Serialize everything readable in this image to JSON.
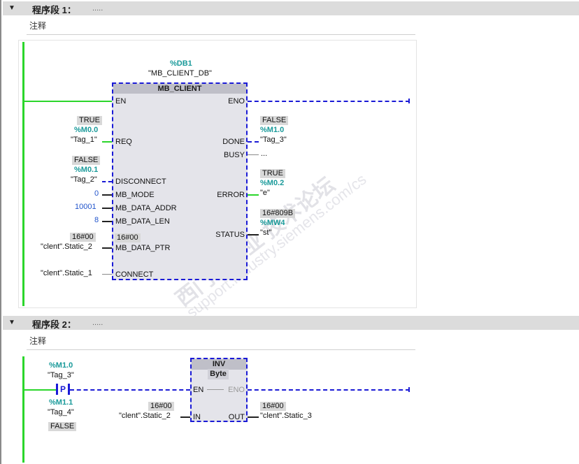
{
  "networks": [
    {
      "title": "程序段 1：",
      "dots": ".....",
      "comment": "注释",
      "block": {
        "db_address": "%DB1",
        "db_name": "\"MB_CLIENT_DB\"",
        "name": "MB_CLIENT",
        "inputs": [
          "EN",
          "REQ",
          "DISCONNECT",
          "MB_MODE",
          "MB_DATA_ADDR",
          "MB_DATA_LEN",
          "MB_DATA_PTR",
          "CONNECT"
        ],
        "outputs": [
          "ENO",
          "DONE",
          "BUSY",
          "ERROR",
          "STATUS"
        ],
        "ptr_value": "16#00"
      },
      "left_params": {
        "req": {
          "value": "TRUE",
          "address": "%M0.0",
          "tag": "\"Tag_1\""
        },
        "disconnect": {
          "value": "FALSE",
          "address": "%M0.1",
          "tag": "\"Tag_2\""
        },
        "mb_mode": "0",
        "mb_data_addr": "10001",
        "mb_data_len": "8",
        "mb_data_ptr": {
          "value": "16#00",
          "tag": "\"clent\".Static_2"
        },
        "connect": "\"clent\".Static_1"
      },
      "right_params": {
        "done": {
          "value": "FALSE",
          "address": "%M1.0",
          "tag": "\"Tag_3\""
        },
        "busy": "...",
        "error": {
          "value": "TRUE",
          "address": "%M0.2",
          "tag": "\"e\""
        },
        "status": {
          "value": "16#809B",
          "address": "%MW4",
          "tag": "\"st\""
        }
      }
    },
    {
      "title": "程序段 2：",
      "dots": ".....",
      "comment": "注释",
      "contact": {
        "address": "%M1.0",
        "tag": "\"Tag_3\"",
        "symbol": "P",
        "edge_address": "%M1.1",
        "edge_tag": "\"Tag_4\"",
        "edge_value": "FALSE"
      },
      "block": {
        "name": "INV",
        "type": "Byte",
        "inputs": [
          "EN",
          "IN"
        ],
        "outputs": [
          "ENO",
          "OUT"
        ],
        "in": {
          "value": "16#00",
          "tag": "\"clent\".Static_2"
        },
        "out": {
          "value": "16#00",
          "tag": "\"clent\".Static_3"
        }
      }
    }
  ],
  "watermark": {
    "cn": "西门子工业 技术论坛",
    "en": "support.industry.siemens.com/cs"
  },
  "colors": {
    "green": "#2bd62b",
    "blue": "#1a1ad6",
    "teal": "#1a9a9a",
    "const_blue": "#2255cc"
  }
}
